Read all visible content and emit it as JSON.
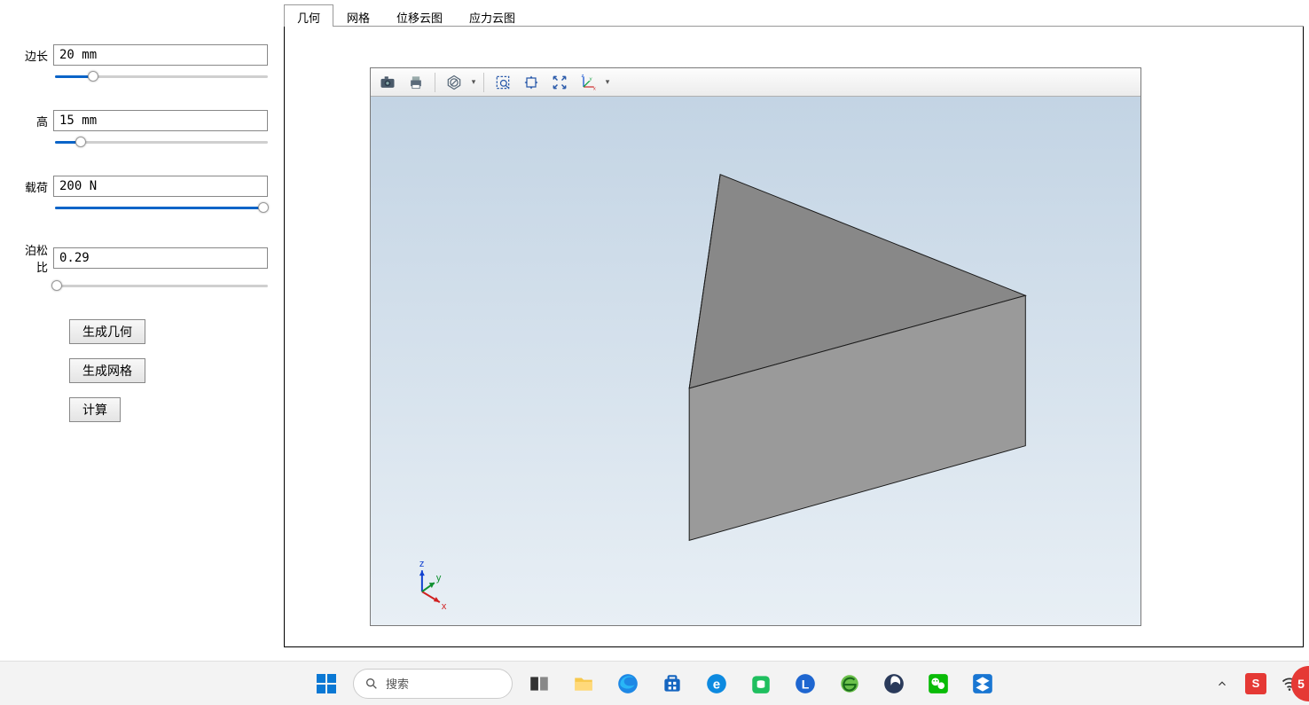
{
  "sidebar": {
    "params": [
      {
        "label": "边长",
        "value": "20 mm",
        "fillPct": 18,
        "thumbPct": 18
      },
      {
        "label": "高",
        "value": "15 mm",
        "fillPct": 12,
        "thumbPct": 12
      },
      {
        "label": "载荷",
        "value": "200 N",
        "fillPct": 98,
        "thumbPct": 98
      },
      {
        "label": "泊松比",
        "value": "0.29",
        "fillPct": 1,
        "thumbPct": 1
      }
    ],
    "buttons": {
      "gen_geom": "生成几何",
      "gen_mesh": "生成网格",
      "compute": "计算"
    }
  },
  "tabs": {
    "items": [
      "几何",
      "网格",
      "位移云图",
      "应力云图"
    ],
    "activeIndex": 0
  },
  "toolbar": {
    "icons": [
      "camera-icon",
      "print-icon",
      "no-entry-icon",
      "zoom-box-icon",
      "pan-icon",
      "fit-icon",
      "axes-icon"
    ]
  },
  "triad": {
    "x": "x",
    "y": "y",
    "z": "z"
  },
  "taskbar": {
    "search_placeholder": "搜索",
    "tray_ime": "S"
  }
}
